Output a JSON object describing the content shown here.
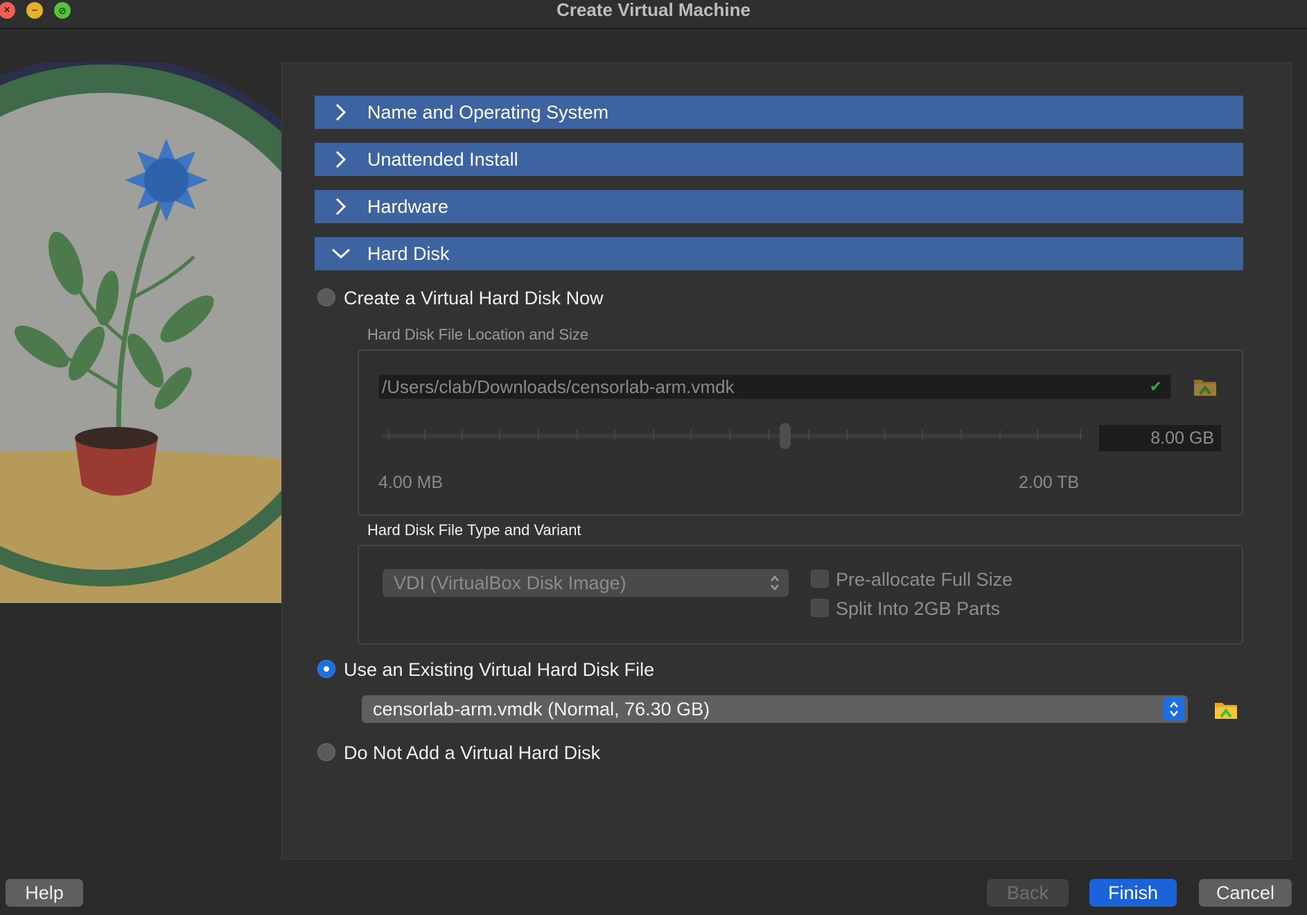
{
  "window": {
    "title": "Create Virtual Machine"
  },
  "sections": [
    {
      "label": "Name and Operating System",
      "expanded": false
    },
    {
      "label": "Unattended Install",
      "expanded": false
    },
    {
      "label": "Hardware",
      "expanded": false
    },
    {
      "label": "Hard Disk",
      "expanded": true
    }
  ],
  "hard_disk": {
    "option_create": "Create a Virtual Hard Disk Now",
    "location_caption": "Hard Disk File Location and Size",
    "path": "/Users/clab/Downloads/censorlab-arm.vmdk",
    "size_value": "8.00 GB",
    "size_fraction": 0.58,
    "min_label": "4.00 MB",
    "max_label": "2.00 TB",
    "type_caption": "Hard Disk File Type and Variant",
    "type_value": "VDI (VirtualBox Disk Image)",
    "preallocate_label": "Pre-allocate Full Size",
    "split_label": "Split Into 2GB Parts",
    "option_existing": "Use an Existing Virtual Hard Disk File",
    "existing_value": "censorlab-arm.vmdk (Normal, 76.30 GB)",
    "option_none": "Do Not Add a Virtual Hard Disk",
    "selected_option": "existing"
  },
  "buttons": {
    "help": "Help",
    "back": "Back",
    "finish": "Finish",
    "cancel": "Cancel"
  },
  "colors": {
    "section_header": "#3d63a0",
    "accent": "#1c6fe0"
  }
}
